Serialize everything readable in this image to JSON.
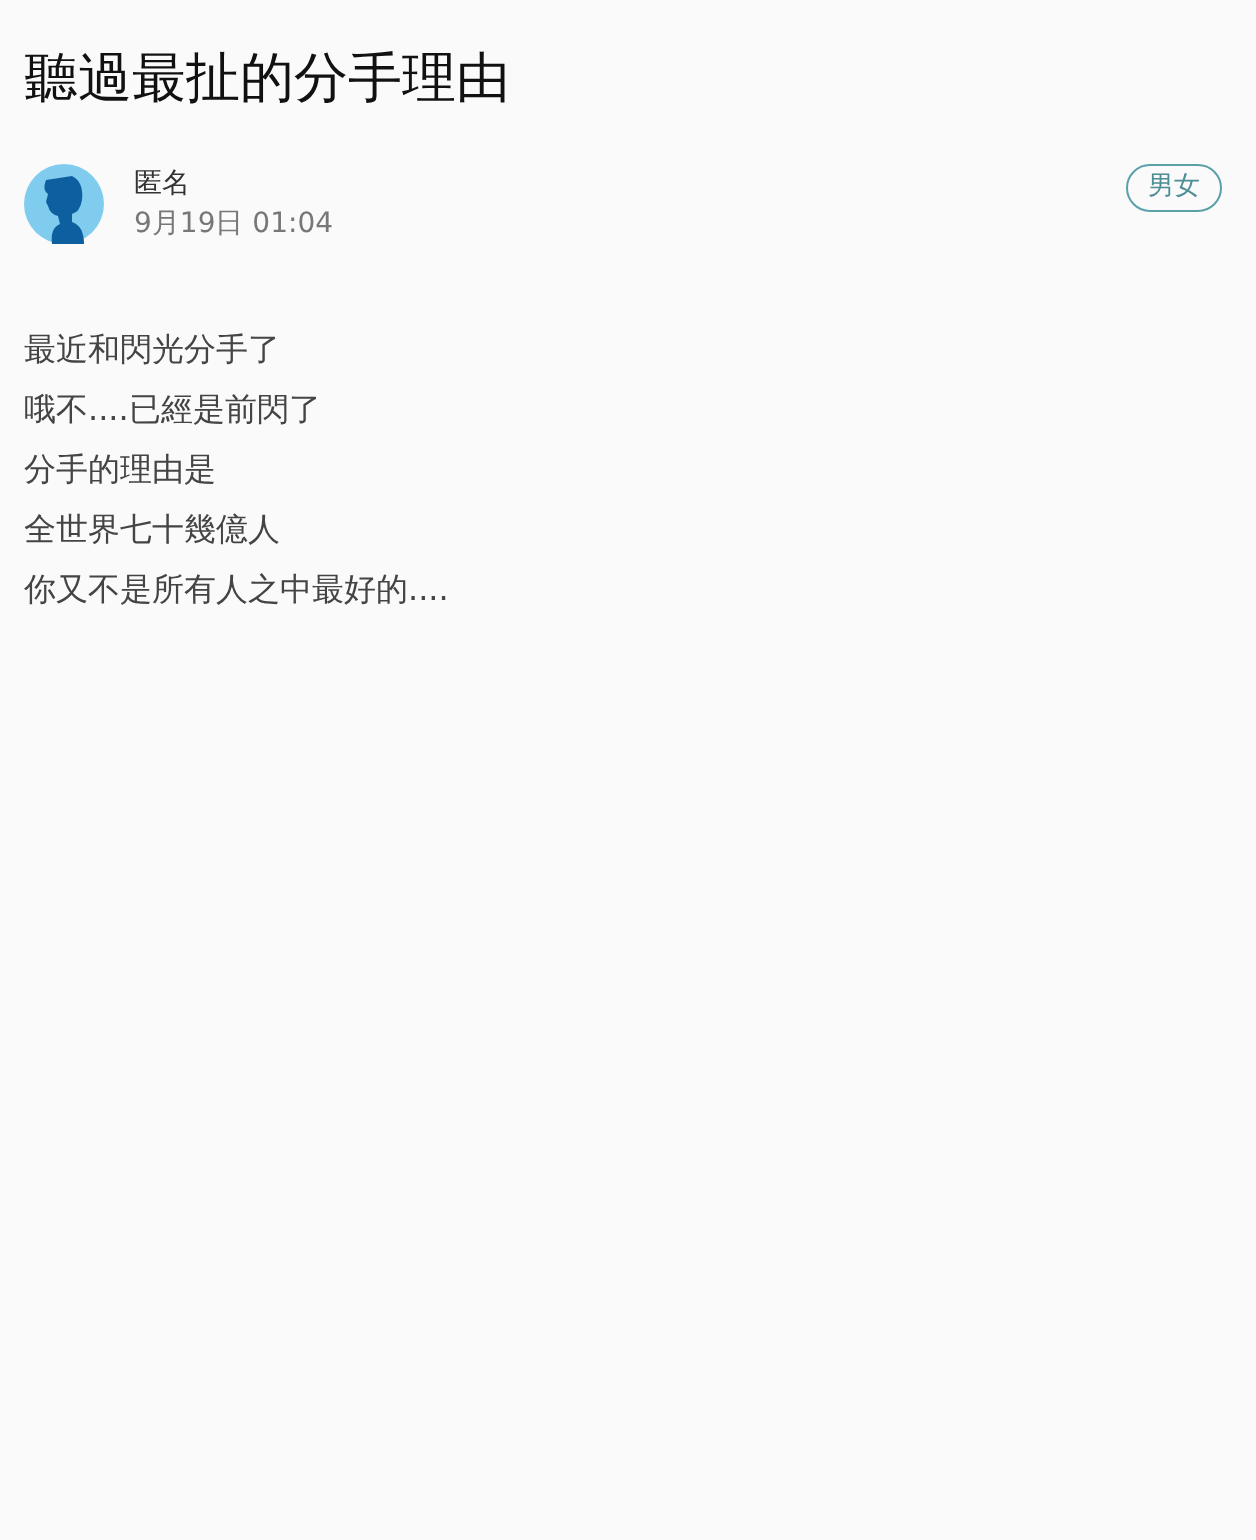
{
  "title": "聽過最扯的分手理由",
  "author": {
    "name": "匿名",
    "time": "9月19日 01:04"
  },
  "tag": "男女",
  "body": [
    "最近和閃光分手了",
    "哦不....已經是前閃了",
    "分手的理由是",
    "全世界七十幾億人",
    "你又不是所有人之中最好的...."
  ]
}
